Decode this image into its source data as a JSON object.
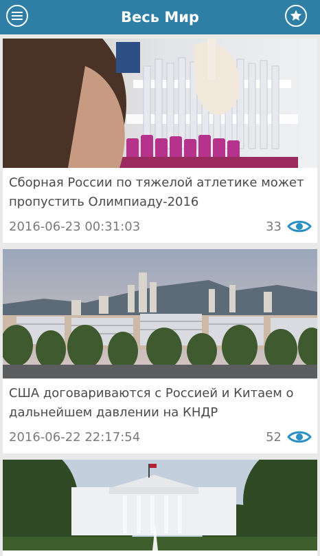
{
  "header": {
    "title": "Весь Мир",
    "menu_icon": "hamburger-menu-icon",
    "favorites_icon": "star-icon"
  },
  "articles": [
    {
      "title": "Сборная России по тяжелой атлетике может пропустить Олимпиаду-2016",
      "date": "2016-06-23 00:31:03",
      "views": "33",
      "image": "lab-test-tubes-photo"
    },
    {
      "title": "США договариваются с Россией и Китаем о дальнейшем давлении на КНДР",
      "date": "2016-06-22 22:17:54",
      "views": "52",
      "image": "city-skyline-photo"
    },
    {
      "image": "white-house-photo"
    }
  ],
  "colors": {
    "accent": "#2f7ea6",
    "eye_icon": "#2a8fc3"
  }
}
